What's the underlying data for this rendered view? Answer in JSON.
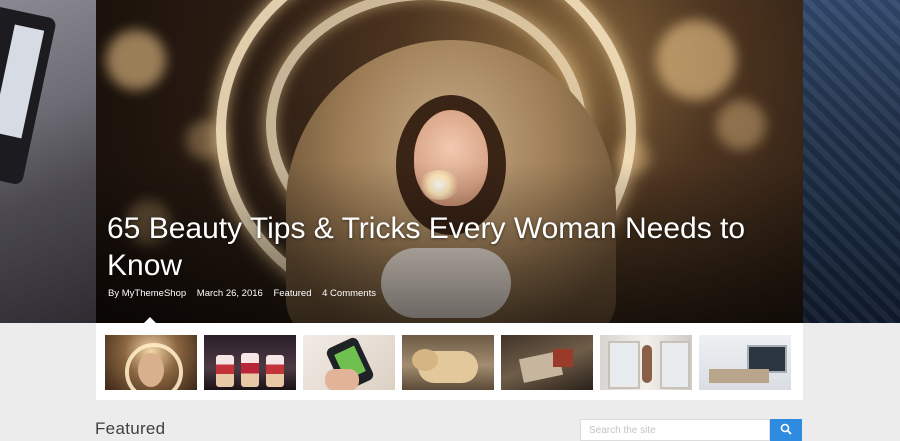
{
  "hero": {
    "title": "65 Beauty Tips & Tricks Every Woman Needs to Know",
    "author": "By MyThemeShop",
    "date": "March 26, 2016",
    "category": "Featured",
    "comments": "4 Comments"
  },
  "thumbnails": [
    {
      "label": "Woman with sparkler thumbnail"
    },
    {
      "label": "Dessert cups thumbnail"
    },
    {
      "label": "Phone in hand thumbnail"
    },
    {
      "label": "Sleeping dog thumbnail"
    },
    {
      "label": "Gift box on table thumbnail"
    },
    {
      "label": "Woman by window thumbnail"
    },
    {
      "label": "Laptop desk thumbnail"
    }
  ],
  "section": {
    "featured_label": "Featured"
  },
  "search": {
    "placeholder": "Search the site"
  },
  "colors": {
    "accent": "#2e8be0",
    "background": "#ececec"
  }
}
